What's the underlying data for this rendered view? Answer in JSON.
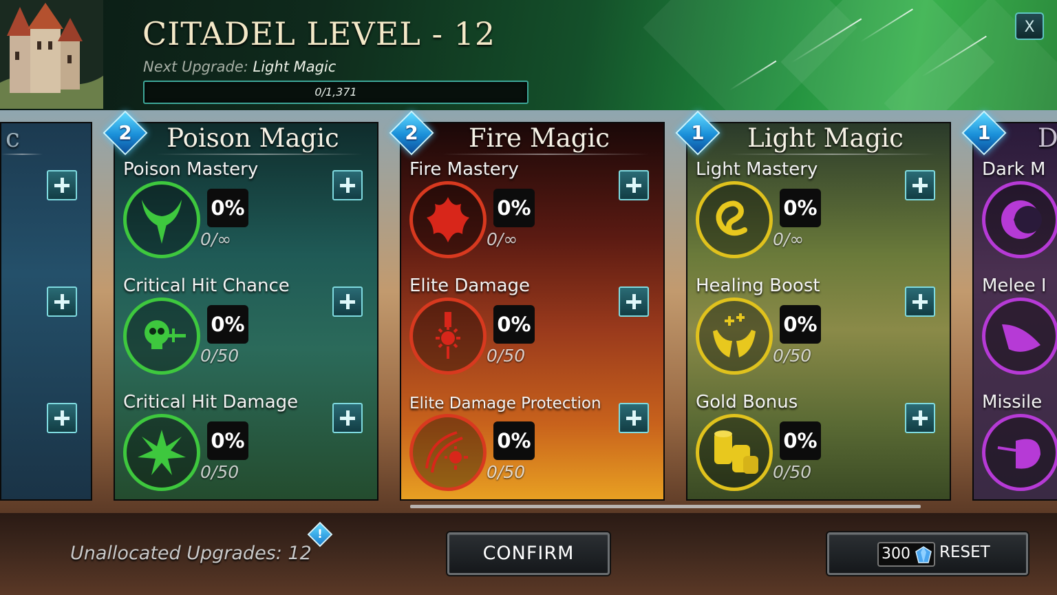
{
  "header": {
    "title": "CITADEL LEVEL - 12",
    "next_upgrade_label": "Next Upgrade:",
    "next_upgrade_value": "Light Magic",
    "progress_text": "0/1,371",
    "progress_fraction": 0,
    "close_label": "X"
  },
  "panels": {
    "left_partial": {
      "title": "c"
    },
    "poison": {
      "title": "Poison Magic",
      "badge": "2",
      "stats": [
        {
          "name": "Poison Mastery",
          "percent": "0%",
          "count": "0/∞",
          "icon": "poison-horns-icon"
        },
        {
          "name": "Critical Hit Chance",
          "percent": "0%",
          "count": "0/50",
          "icon": "skull-dagger-icon"
        },
        {
          "name": "Critical Hit Damage",
          "percent": "0%",
          "count": "0/50",
          "icon": "burst-icon"
        }
      ]
    },
    "fire": {
      "title": "Fire Magic",
      "badge": "2",
      "stats": [
        {
          "name": "Fire Mastery",
          "percent": "0%",
          "count": "0/∞",
          "icon": "flame-icon"
        },
        {
          "name": "Elite Damage",
          "percent": "0%",
          "count": "0/50",
          "icon": "medal-sun-icon"
        },
        {
          "name": "Elite Damage Protection",
          "percent": "0%",
          "count": "0/50",
          "icon": "shield-sun-icon"
        }
      ]
    },
    "light": {
      "title": "Light Magic",
      "badge": "1",
      "stats": [
        {
          "name": "Light Mastery",
          "percent": "0%",
          "count": "0/∞",
          "icon": "swirl-icon"
        },
        {
          "name": "Healing Boost",
          "percent": "0%",
          "count": "0/50",
          "icon": "healing-hands-icon"
        },
        {
          "name": "Gold Bonus",
          "percent": "0%",
          "count": "0/50",
          "icon": "gold-coins-icon"
        }
      ]
    },
    "dark_partial": {
      "title": "D",
      "badge": "1",
      "stats": [
        {
          "name": "Dark M"
        },
        {
          "name": "Melee I"
        },
        {
          "name": "Missile"
        }
      ]
    }
  },
  "footer": {
    "unallocated": "Unallocated Upgrades: 12",
    "alert": "!",
    "confirm_label": "CONFIRM",
    "reset_cost": "300",
    "reset_label": "RESET"
  },
  "colors": {
    "poison": "#3ec83e",
    "fire": "#d8391f",
    "light": "#e0c21d",
    "dark": "#b63ad6",
    "accent": "#5fc6c3"
  }
}
